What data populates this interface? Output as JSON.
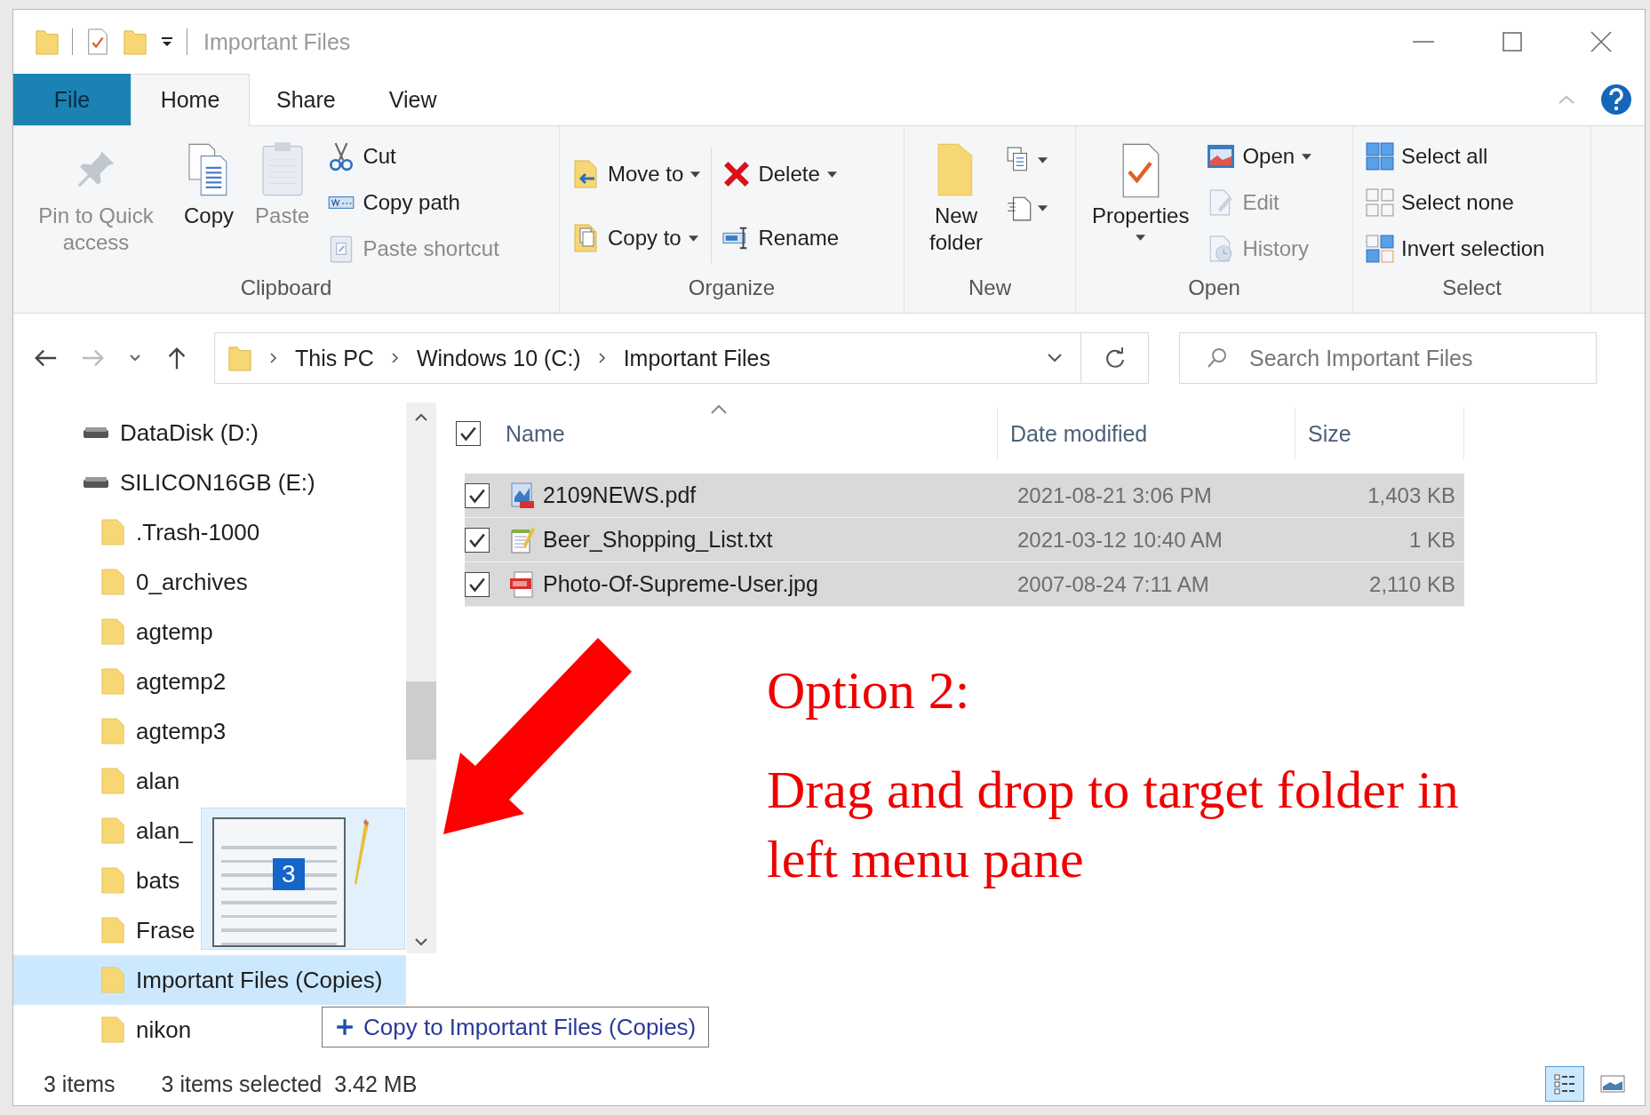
{
  "window": {
    "title": "Important Files"
  },
  "tabs": [
    {
      "label": "File",
      "kind": "file",
      "selected": false
    },
    {
      "label": "Home",
      "kind": "tab",
      "selected": true
    },
    {
      "label": "Share",
      "kind": "tab",
      "selected": false
    },
    {
      "label": "View",
      "kind": "tab",
      "selected": false
    }
  ],
  "clipboard": {
    "label": "Clipboard",
    "pin": {
      "label": "Pin to Quick access",
      "disabled": true
    },
    "copy": {
      "label": "Copy",
      "disabled": false
    },
    "paste": {
      "label": "Paste",
      "disabled": true
    },
    "cut": {
      "label": "Cut",
      "disabled": false
    },
    "copy_path": {
      "label": "Copy path",
      "disabled": false
    },
    "paste_shortcut": {
      "label": "Paste shortcut",
      "disabled": true
    }
  },
  "organize": {
    "label": "Organize",
    "move_to": {
      "label": "Move to",
      "disabled": false
    },
    "copy_to": {
      "label": "Copy to",
      "disabled": false
    },
    "delete": {
      "label": "Delete",
      "disabled": false
    },
    "rename": {
      "label": "Rename",
      "disabled": false
    }
  },
  "new": {
    "label": "New",
    "new_folder": {
      "label": "New folder",
      "disabled": false
    }
  },
  "open": {
    "label": "Open",
    "properties": {
      "label": "Properties",
      "disabled": false
    },
    "open": {
      "label": "Open",
      "disabled": false
    },
    "edit": {
      "label": "Edit",
      "disabled": true
    },
    "history": {
      "label": "History",
      "disabled": true
    }
  },
  "select": {
    "label": "Select",
    "select_all": {
      "label": "Select all",
      "disabled": false
    },
    "select_none": {
      "label": "Select none",
      "disabled": false
    },
    "invert_selection": {
      "label": "Invert selection",
      "disabled": false
    }
  },
  "address": {
    "breadcrumbs": [
      "This PC",
      "Windows 10 (C:)",
      "Important Files"
    ]
  },
  "search": {
    "placeholder": "Search Important Files"
  },
  "nav_items": [
    {
      "label": "DataDisk (D:)",
      "kind": "drive",
      "selected": false
    },
    {
      "label": "SILICON16GB (E:)",
      "kind": "drive",
      "selected": false
    },
    {
      "label": ".Trash-1000",
      "kind": "folder",
      "selected": false
    },
    {
      "label": "0_archives",
      "kind": "folder",
      "selected": false
    },
    {
      "label": "agtemp",
      "kind": "folder",
      "selected": false
    },
    {
      "label": "agtemp2",
      "kind": "folder",
      "selected": false
    },
    {
      "label": "agtemp3",
      "kind": "folder",
      "selected": false
    },
    {
      "label": "alan",
      "kind": "folder",
      "selected": false
    },
    {
      "label": "alan_",
      "kind": "folder",
      "selected": false
    },
    {
      "label": "bats",
      "kind": "folder",
      "selected": false
    },
    {
      "label": "Frase",
      "kind": "folder",
      "selected": false
    },
    {
      "label": "Important Files (Copies)",
      "kind": "folder",
      "selected": true
    },
    {
      "label": "nikon",
      "kind": "folder",
      "selected": false
    }
  ],
  "columns": [
    "Name",
    "Date modified",
    "Size"
  ],
  "select_all_checked": true,
  "files": [
    {
      "name": "2109NEWS.pdf",
      "kind": "pdf",
      "date": "2021-08-21 3:06 PM",
      "size": "1,403 KB",
      "selected": true,
      "checked": true
    },
    {
      "name": "Beer_Shopping_List.txt",
      "kind": "txt",
      "date": "2021-03-12 10:40 AM",
      "size": "1 KB",
      "selected": true,
      "checked": true
    },
    {
      "name": "Photo-Of-Supreme-User.jpg",
      "kind": "jpg",
      "date": "2007-08-24 7:11 AM",
      "size": "2,110 KB",
      "selected": true,
      "checked": true
    }
  ],
  "drag": {
    "count": "3",
    "tooltip": "Copy to Important Files (Copies)"
  },
  "status": {
    "items": "3 items",
    "selection": "3 items selected",
    "size": "3.42 MB"
  },
  "annotation": {
    "heading": "Option 2:",
    "body": "Drag and drop to target folder in left menu pane"
  }
}
